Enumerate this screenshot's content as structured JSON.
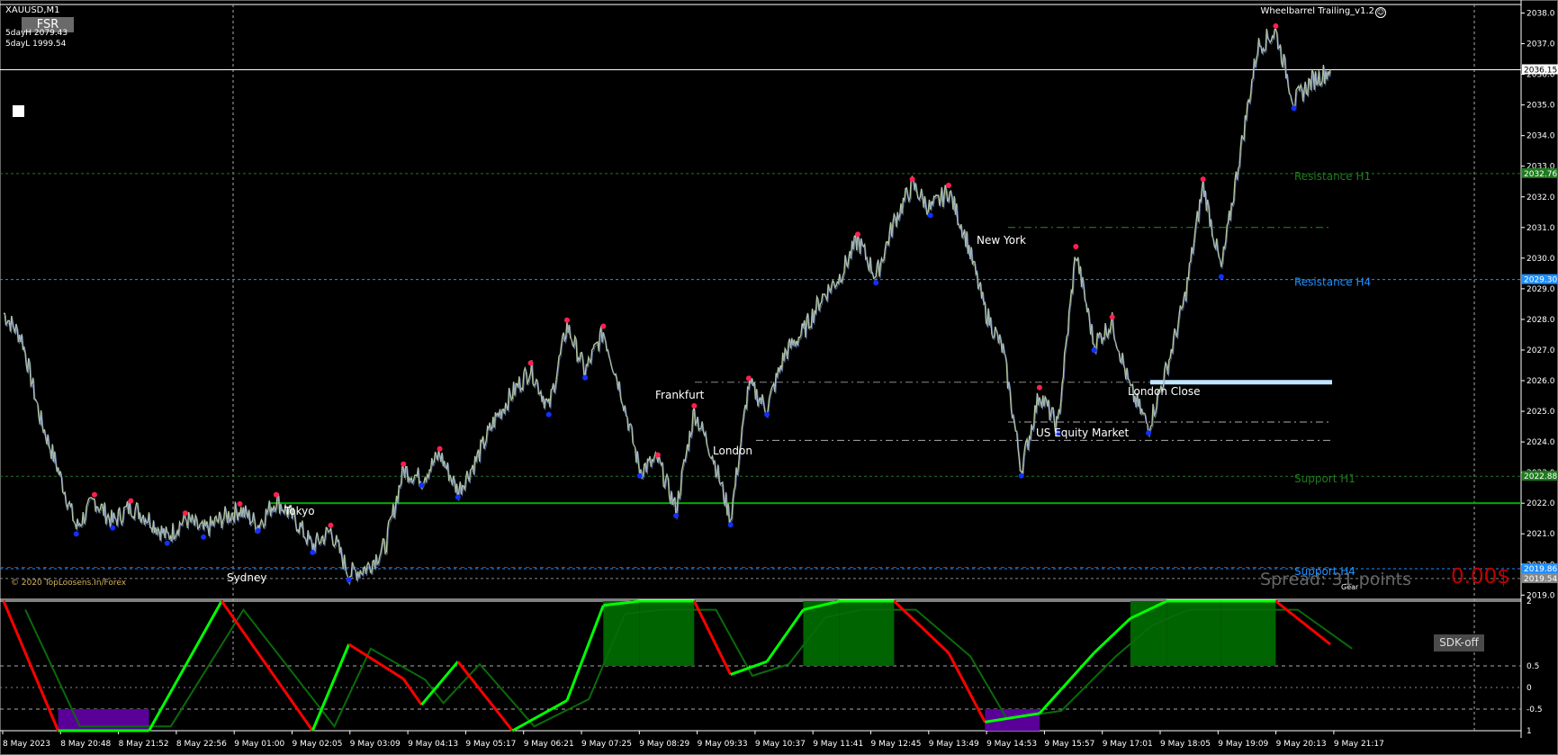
{
  "symbol": "XAUUSD,M1",
  "fsr_label": "FSR",
  "stats": [
    "5dayH 2079.43",
    "5dayL 1999.54"
  ],
  "ea_name": "Wheelbarrel Trailing_v1.2",
  "copyright": "© 2020 TopLoosens.In/Forex",
  "spread_text": "Spread: 31 points",
  "cost_text": "0.00$",
  "button_sdk": "SDK-off",
  "gear_text": "Gear",
  "colors": {
    "bull_candle": "#b4c8a0",
    "bear_candle": "#7a8fd0",
    "resistance_h1": "#1e7a1e",
    "resistance_h4": "#1e90ff",
    "support_h1": "#1e7a1e",
    "support_h4": "#1e90ff",
    "strong_line": "#00aa00",
    "indicator_red": "#ff0000",
    "indicator_green": "#00ff00",
    "fill_green": "#006400",
    "fill_purple": "#5a0099"
  },
  "chart_data": [
    {
      "type": "line",
      "name": "XAUUSD M1 price",
      "x_labels": [
        "8 May 2023",
        "8 May 20:48",
        "8 May 21:52",
        "8 May 22:56",
        "9 May 01:00",
        "9 May 02:05",
        "9 May 03:09",
        "9 May 04:13",
        "9 May 05:17",
        "9 May 06:21",
        "9 May 07:25",
        "9 May 08:29",
        "9 May 09:33",
        "9 May 10:37",
        "9 May 11:41",
        "9 May 12:45",
        "9 May 13:49",
        "9 May 14:53",
        "9 May 15:57",
        "9 May 17:01",
        "9 May 18:05",
        "9 May 19:09",
        "9 May 20:13",
        "9 May 21:17"
      ],
      "y_ticks": [
        2019.0,
        2020.0,
        2021.0,
        2022.0,
        2023.0,
        2024.0,
        2025.0,
        2026.0,
        2027.0,
        2028.0,
        2029.0,
        2030.0,
        2031.0,
        2032.0,
        2033.0,
        2034.0,
        2035.0,
        2036.0,
        2037.0,
        2038.0
      ],
      "ylim": [
        2018.95,
        2038.25
      ],
      "current_price": "2036.15",
      "price_path": [
        [
          0,
          2028.2
        ],
        [
          1,
          2027.4
        ],
        [
          2,
          2024.8
        ],
        [
          3,
          2023.1
        ],
        [
          4,
          2021.2
        ],
        [
          5,
          2022.1
        ],
        [
          6,
          2021.4
        ],
        [
          7,
          2021.9
        ],
        [
          8,
          2021.5
        ],
        [
          9,
          2020.9
        ],
        [
          10,
          2021.5
        ],
        [
          11,
          2021.1
        ],
        [
          12,
          2021.5
        ],
        [
          13,
          2021.8
        ],
        [
          14,
          2021.3
        ],
        [
          15,
          2022.1
        ],
        [
          16,
          2021.5
        ],
        [
          17,
          2020.6
        ],
        [
          18,
          2021.1
        ],
        [
          19,
          2019.7
        ],
        [
          20,
          2019.9
        ],
        [
          21,
          2020.6
        ],
        [
          22,
          2023.1
        ],
        [
          23,
          2022.8
        ],
        [
          24,
          2023.6
        ],
        [
          25,
          2022.4
        ],
        [
          26,
          2023.4
        ],
        [
          27,
          2024.7
        ],
        [
          28,
          2025.6
        ],
        [
          29,
          2026.4
        ],
        [
          30,
          2025.1
        ],
        [
          31,
          2027.8
        ],
        [
          32,
          2026.3
        ],
        [
          33,
          2027.6
        ],
        [
          34,
          2025.6
        ],
        [
          35,
          2023.1
        ],
        [
          36,
          2023.4
        ],
        [
          37,
          2021.8
        ],
        [
          38,
          2025.0
        ],
        [
          39,
          2023.6
        ],
        [
          40,
          2021.5
        ],
        [
          41,
          2025.9
        ],
        [
          42,
          2025.1
        ],
        [
          43,
          2026.9
        ],
        [
          44,
          2027.6
        ],
        [
          45,
          2028.7
        ],
        [
          46,
          2029.4
        ],
        [
          47,
          2030.6
        ],
        [
          48,
          2029.4
        ],
        [
          49,
          2031.2
        ],
        [
          50,
          2032.4
        ],
        [
          51,
          2031.6
        ],
        [
          52,
          2032.2
        ],
        [
          53,
          2030.6
        ],
        [
          54,
          2028.3
        ],
        [
          55,
          2027.0
        ],
        [
          56,
          2023.1
        ],
        [
          57,
          2025.6
        ],
        [
          58,
          2024.5
        ],
        [
          59,
          2030.2
        ],
        [
          60,
          2027.2
        ],
        [
          61,
          2027.9
        ],
        [
          62,
          2025.7
        ],
        [
          63,
          2024.5
        ],
        [
          64,
          2026.4
        ],
        [
          65,
          2028.7
        ],
        [
          66,
          2032.4
        ],
        [
          67,
          2029.6
        ],
        [
          68,
          2033.3
        ],
        [
          69,
          2036.9
        ],
        [
          70,
          2037.4
        ],
        [
          71,
          2035.1
        ],
        [
          72,
          2035.8
        ],
        [
          73,
          2036.15
        ]
      ],
      "sessions": [
        "Sydney",
        "Tokyo",
        "Frankfurt",
        "London",
        "New York",
        "US Equity Market",
        "London Close"
      ],
      "levels": [
        {
          "label": "Resistance H1",
          "price": "2032.76"
        },
        {
          "label": "Resistance H4",
          "price": "2029.30"
        },
        {
          "label": "Support H1",
          "price": "2022.88"
        },
        {
          "label": "Support H4",
          "price": "2019.86"
        },
        {
          "label": "",
          "price": "2019.54"
        }
      ],
      "strong_level": 2022.0,
      "session_levels": [
        2031.0,
        2025.95,
        2024.65,
        2024.05,
        2019.9
      ]
    },
    {
      "type": "line",
      "name": "Oscillator",
      "y_ticks": [
        "2",
        "0.5",
        "0",
        "-0.5",
        "1"
      ],
      "ylim": [
        -1,
        2
      ],
      "zones": [
        0.5,
        -0.5
      ],
      "series_red": [
        [
          0,
          2
        ],
        [
          3,
          -1
        ],
        [
          8,
          -1
        ],
        [
          12,
          2
        ],
        [
          17,
          -1
        ],
        [
          19,
          1
        ],
        [
          22,
          0.2
        ],
        [
          23,
          -0.4
        ],
        [
          25,
          0.6
        ],
        [
          28,
          -1
        ],
        [
          31,
          -0.3
        ],
        [
          33,
          1.9
        ],
        [
          35,
          2
        ],
        [
          38,
          2
        ],
        [
          40,
          0.3
        ],
        [
          42,
          0.6
        ],
        [
          44,
          1.8
        ],
        [
          46,
          2
        ],
        [
          49,
          2
        ],
        [
          52,
          0.8
        ],
        [
          54,
          -0.8
        ],
        [
          57,
          -0.6
        ],
        [
          60,
          0.8
        ],
        [
          62,
          1.6
        ],
        [
          64,
          2
        ],
        [
          67,
          2
        ],
        [
          70,
          2
        ],
        [
          73,
          1
        ]
      ]
    }
  ]
}
